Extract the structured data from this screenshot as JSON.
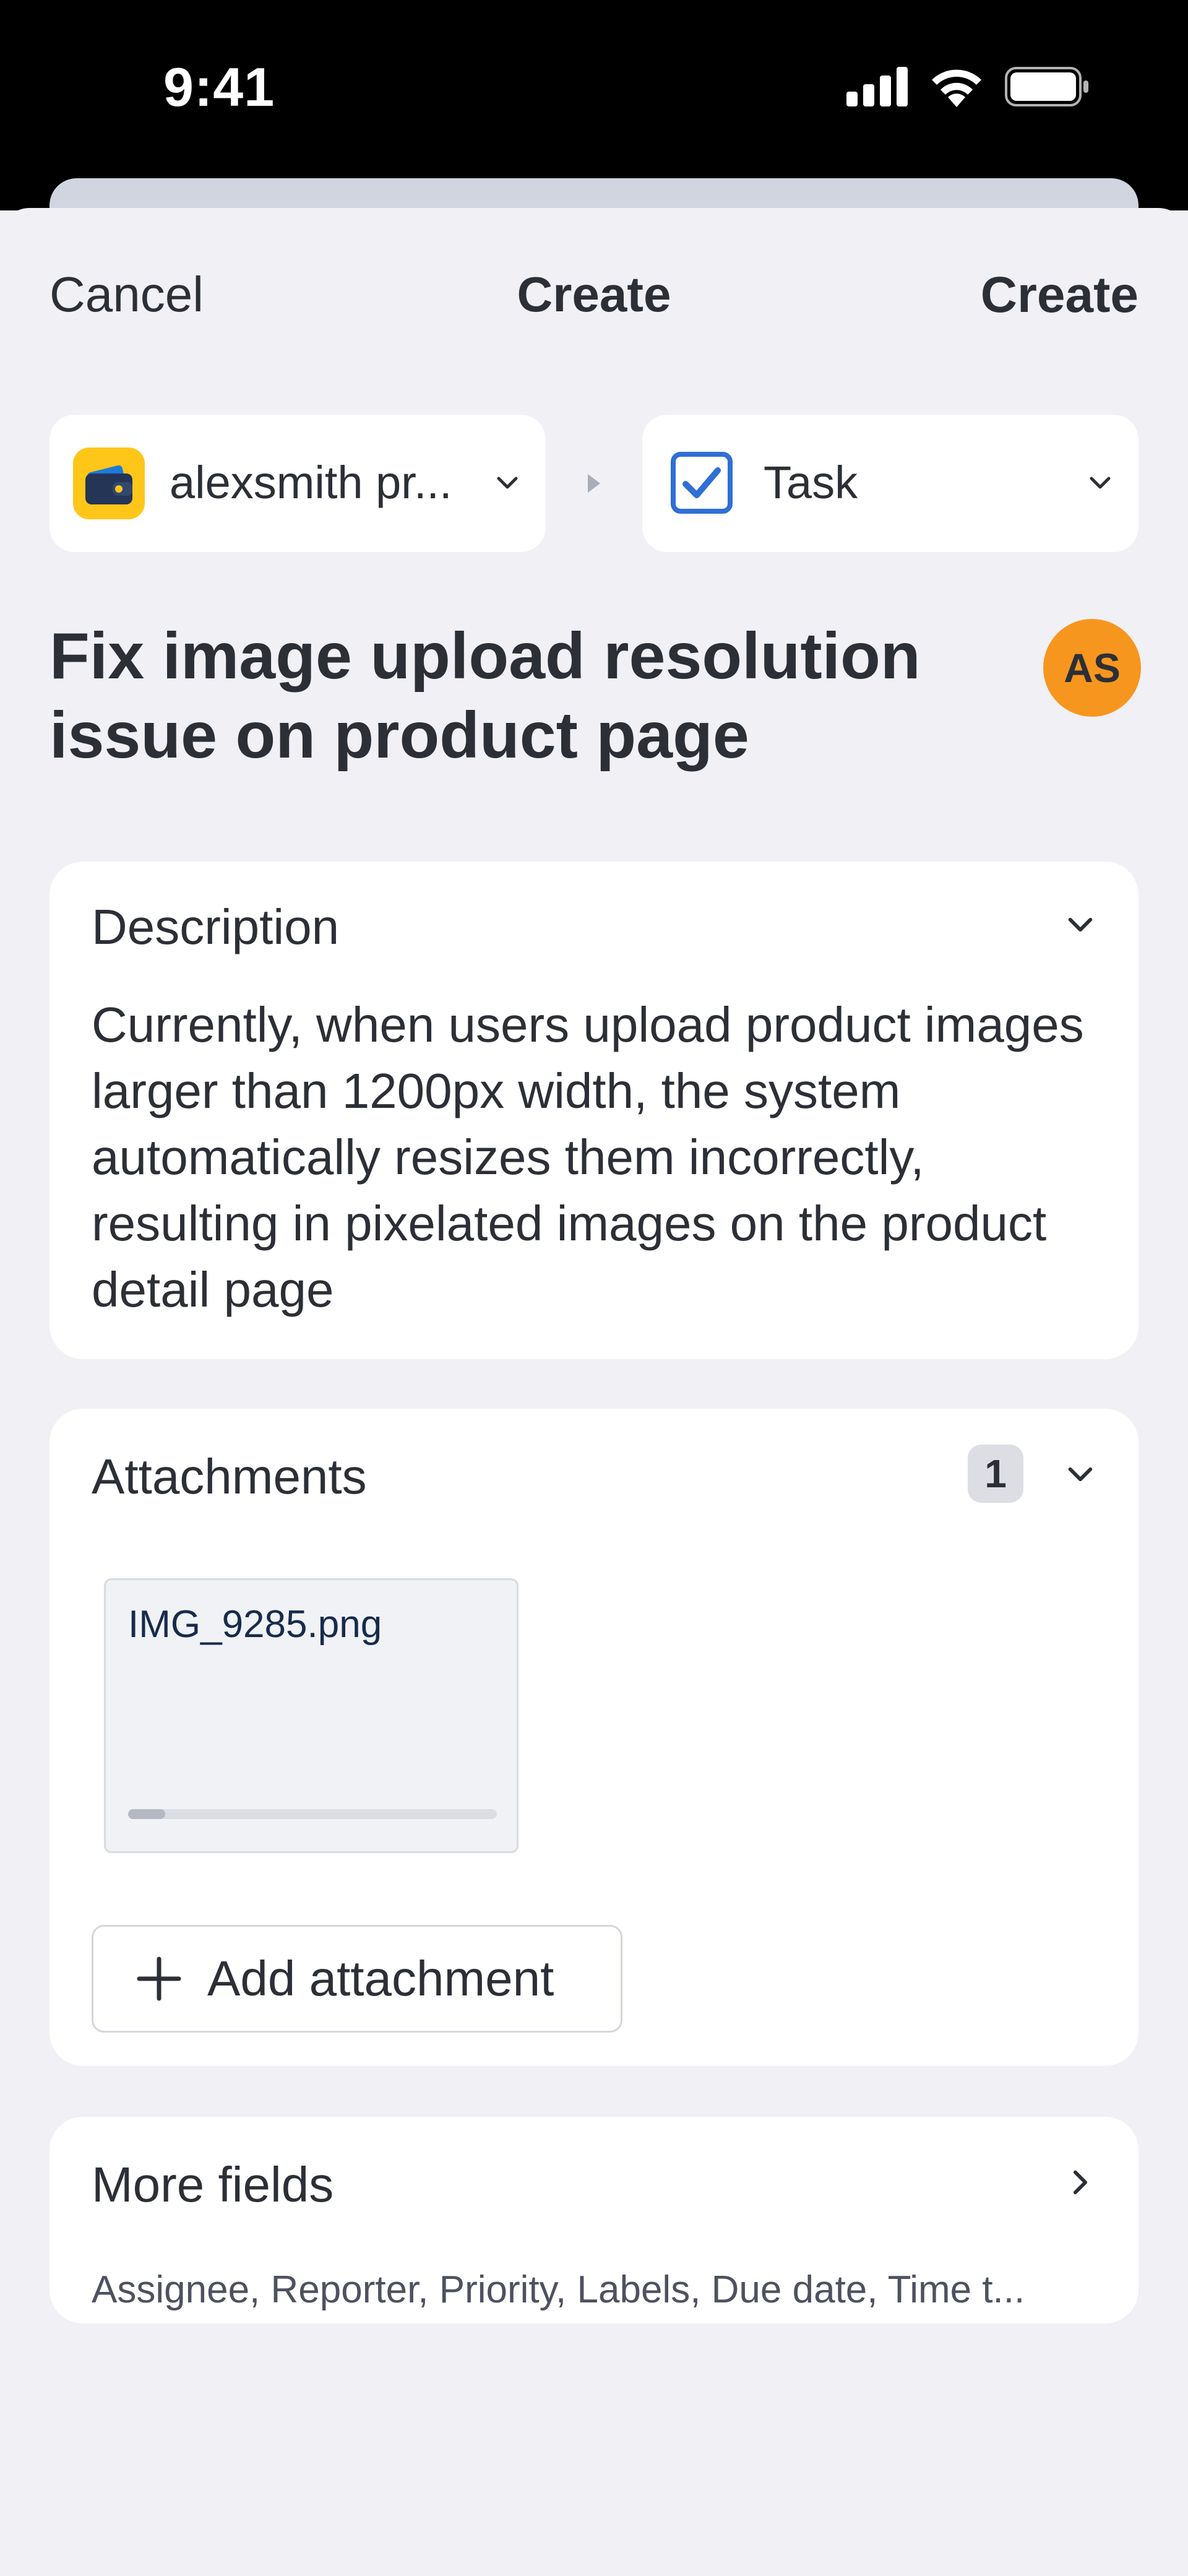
{
  "status": {
    "time": "9:41"
  },
  "nav": {
    "cancel_label": "Cancel",
    "title": "Create",
    "create_label": "Create"
  },
  "project_picker": {
    "label": "alexsmith pr..."
  },
  "type_picker": {
    "label": "Task"
  },
  "issue": {
    "title": "Fix image upload resolution issue on product page"
  },
  "avatar": {
    "initials": "AS",
    "color": "#f7961e"
  },
  "description": {
    "heading": "Description",
    "text": "Currently, when users upload product images larger than 1200px width, the system automatically resizes them incorrectly, resulting in pixelated images on the product detail page"
  },
  "attachments": {
    "heading": "Attachments",
    "count": "1",
    "items": [
      {
        "filename": "IMG_9285.png",
        "upload_progress": 0.1
      }
    ],
    "add_label": "Add attachment"
  },
  "more_fields": {
    "heading": "More fields",
    "summary": "Assignee, Reporter, Priority, Labels, Due date, Time t..."
  },
  "colors": {
    "accent": "#2f6fd6",
    "project_icon": "#ffc61a"
  }
}
